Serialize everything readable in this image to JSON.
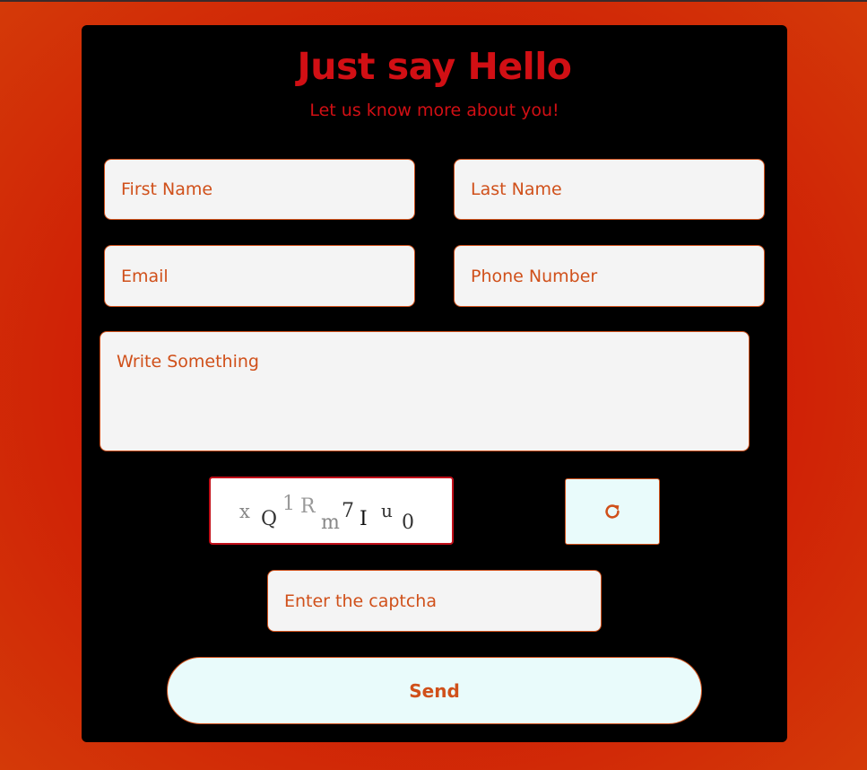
{
  "form": {
    "title": "Just say Hello",
    "subtitle": "Let us know more about you!",
    "fields": {
      "first_name": "First Name",
      "last_name": "Last Name",
      "email": "Email",
      "phone": "Phone Number",
      "message": "Write Something",
      "captcha_input": "Enter the captcha"
    },
    "captcha": {
      "chars": [
        "x",
        "Q",
        "1",
        "R",
        "m",
        "7",
        "I",
        "u",
        "0"
      ]
    },
    "refresh_icon": "refresh-icon",
    "send_label": "Send"
  },
  "colors": {
    "background": "#cf1f06",
    "card": "#000000",
    "title": "#d10f14",
    "accent": "#d0501a",
    "field_bg": "#f4f4f4",
    "button_bg": "#e9fbfb"
  }
}
